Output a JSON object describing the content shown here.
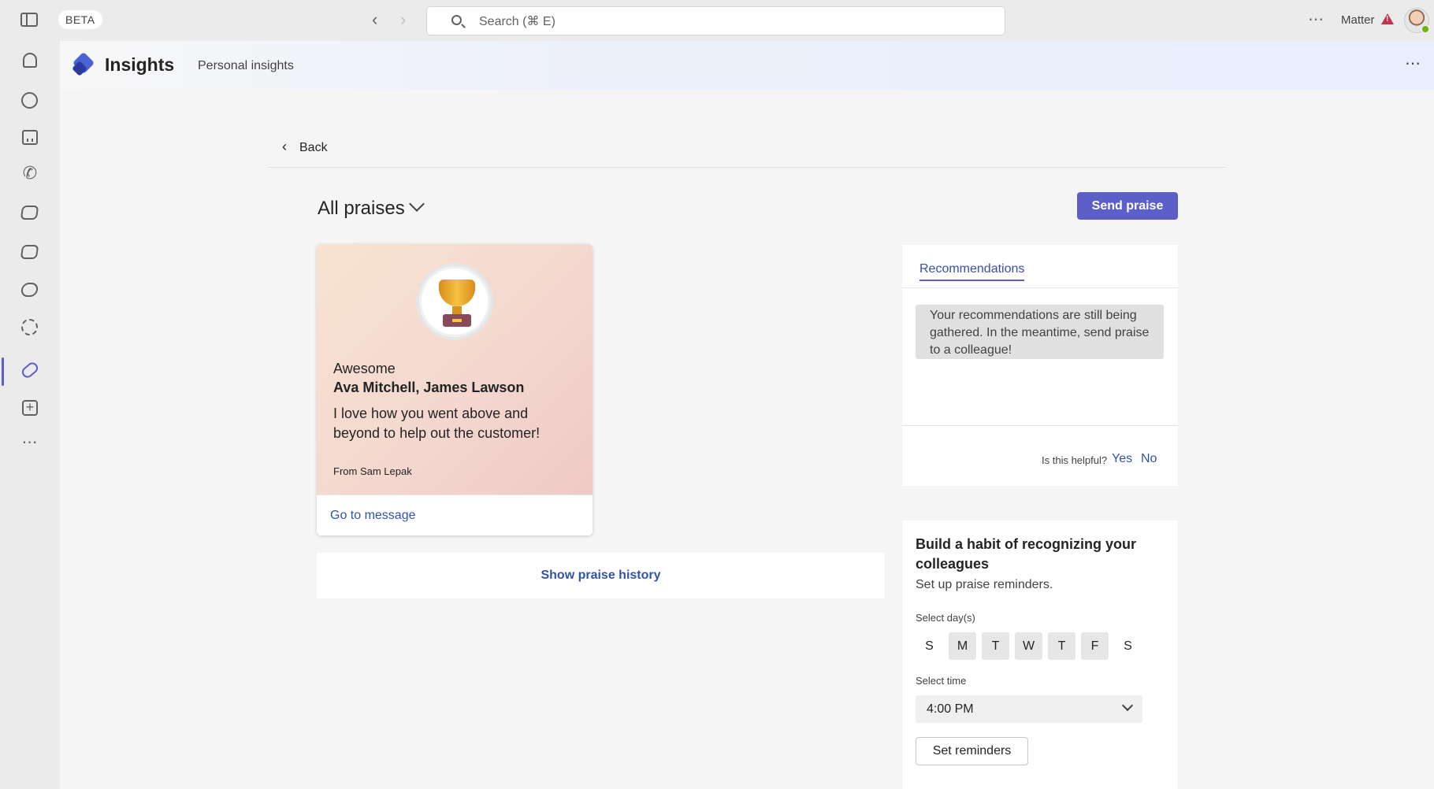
{
  "titlebar": {
    "badge": "BETA",
    "search_placeholder": "Search (⌘ E)",
    "user_name": "Matter",
    "more": "⋯"
  },
  "rail": {
    "items": [
      "bell-icon",
      "chat-icon",
      "calendar-icon",
      "phone-icon",
      "box-icon",
      "box-icon-2",
      "copilot-icon",
      "apps-gear-icon",
      "insights-icon",
      "add-app-icon",
      "more-apps-icon"
    ],
    "active": "insights-icon",
    "more": "⋯"
  },
  "app": {
    "title": "Insights",
    "subtitle": "Personal insights",
    "more": "⋯"
  },
  "nav": {
    "back_label": "Back",
    "back_chevron": "‹"
  },
  "filter": {
    "label": "All praises"
  },
  "send_praise": "Send praise",
  "praise_card": {
    "type": "Awesome",
    "recipients": "Ava Mitchell, James Lawson",
    "message": "I love how you went above and beyond to help out the customer!",
    "from": "From Sam Lepak",
    "link": "Go to message"
  },
  "history_link": "Show praise history",
  "recommendations": {
    "tab": "Recommendations",
    "message": "Your recommendations are still being gathered. In the meantime, send praise to a colleague!",
    "helpful_question": "Is this helpful?",
    "yes": "Yes",
    "no": "No"
  },
  "reminders": {
    "title": "Build a habit of recognizing your colleagues",
    "subtitle": "Set up praise reminders.",
    "days_label": "Select day(s)",
    "days": [
      "S",
      "M",
      "T",
      "W",
      "T",
      "F",
      "S"
    ],
    "selected_days": [
      1,
      2,
      3,
      4,
      5
    ],
    "time_label": "Select time",
    "time_value": "4:00 PM",
    "button": "Set reminders"
  },
  "colors": {
    "accent": "#5b5fc7",
    "link": "#3154a8",
    "warning": "#c4314b",
    "presence": "#6bb700"
  }
}
